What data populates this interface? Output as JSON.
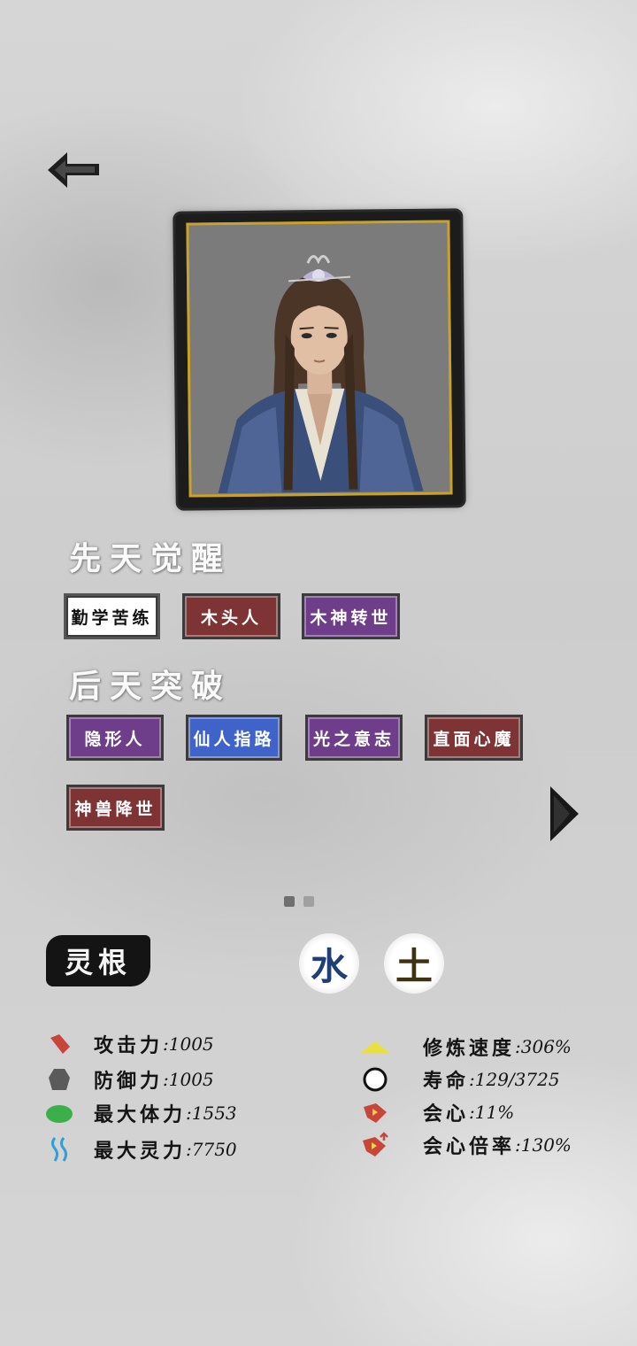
{
  "innate": {
    "title": "先天觉醒",
    "traits": [
      {
        "label": "勤学苦练",
        "color": "white"
      },
      {
        "label": "木头人",
        "color": "red"
      },
      {
        "label": "木神转世",
        "color": "purple"
      }
    ]
  },
  "acquired": {
    "title": "后天突破",
    "traits": [
      {
        "label": "隐形人",
        "color": "purple"
      },
      {
        "label": "仙人指路",
        "color": "blue"
      },
      {
        "label": "光之意志",
        "color": "purple"
      },
      {
        "label": "直面心魔",
        "color": "red"
      },
      {
        "label": "神兽降世",
        "color": "red"
      }
    ]
  },
  "pagination": {
    "current": 1,
    "total": 2
  },
  "spirit_root": {
    "label": "灵根",
    "elements": [
      "水",
      "土"
    ]
  },
  "stats_left": [
    {
      "label": "攻击力",
      "value": ":1005",
      "icon": "attack-icon",
      "color": "#c8453a"
    },
    {
      "label": "防御力",
      "value": ":1005",
      "icon": "defense-icon",
      "color": "#5a5a5a"
    },
    {
      "label": "最大体力",
      "value": ":1553",
      "icon": "stamina-icon",
      "color": "#3bb04a"
    },
    {
      "label": "最大灵力",
      "value": ":7750",
      "icon": "spirit-power-icon",
      "color": "#2f9fd8"
    }
  ],
  "stats_right": [
    {
      "label": "修炼速度",
      "value": ":306%",
      "icon": "cultivation-speed-icon",
      "color": "#e8e040"
    },
    {
      "label": "寿命",
      "value": ":129/3725",
      "icon": "lifespan-icon",
      "color": "#111111"
    },
    {
      "label": "会心",
      "value": ":11%",
      "icon": "critical-icon",
      "color": "#c8453a"
    },
    {
      "label": "会心倍率",
      "value": ":130%",
      "icon": "critical-multiplier-icon",
      "color": "#c8453a"
    }
  ]
}
